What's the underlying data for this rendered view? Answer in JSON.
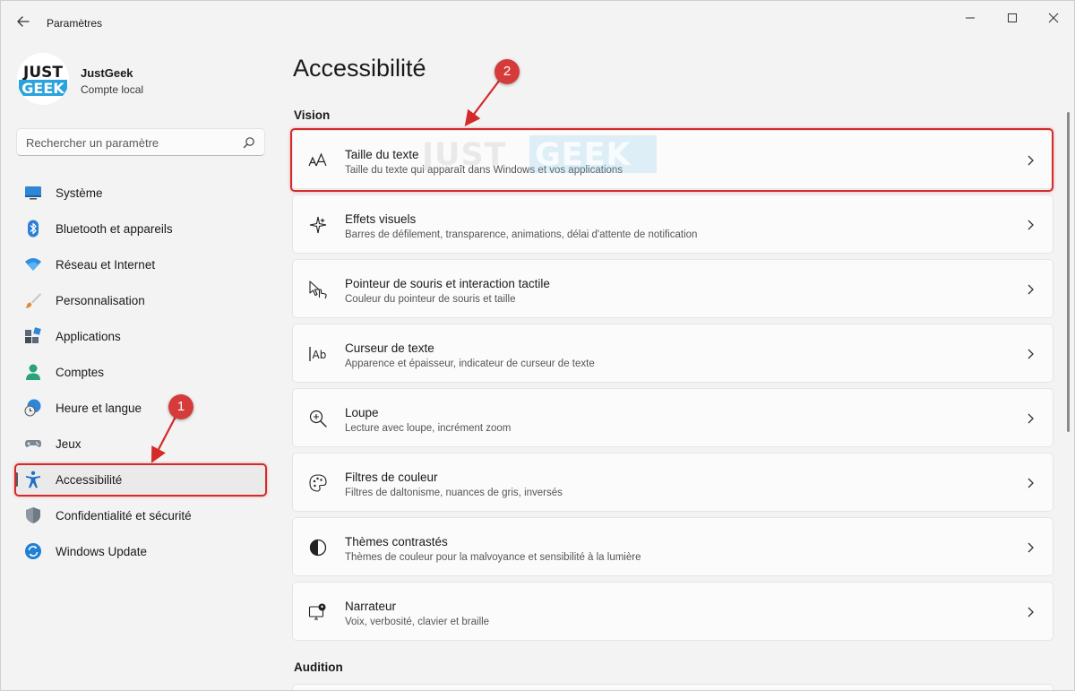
{
  "window": {
    "title": "Paramètres"
  },
  "account": {
    "logo_top": "JUST",
    "logo_bottom": "GEEK",
    "name": "JustGeek",
    "type": "Compte local"
  },
  "search": {
    "placeholder": "Rechercher un paramètre"
  },
  "nav": {
    "items": [
      {
        "label": "Système",
        "icon": "monitor-icon"
      },
      {
        "label": "Bluetooth et appareils",
        "icon": "bluetooth-icon"
      },
      {
        "label": "Réseau et Internet",
        "icon": "wifi-icon"
      },
      {
        "label": "Personnalisation",
        "icon": "brush-icon"
      },
      {
        "label": "Applications",
        "icon": "apps-icon"
      },
      {
        "label": "Comptes",
        "icon": "person-icon"
      },
      {
        "label": "Heure et langue",
        "icon": "clock-globe-icon"
      },
      {
        "label": "Jeux",
        "icon": "gamepad-icon"
      },
      {
        "label": "Accessibilité",
        "icon": "accessibility-icon",
        "active": true
      },
      {
        "label": "Confidentialité et sécurité",
        "icon": "shield-icon"
      },
      {
        "label": "Windows Update",
        "icon": "update-icon"
      }
    ]
  },
  "main": {
    "title": "Accessibilité",
    "sections": [
      {
        "title": "Vision"
      },
      {
        "title": "Audition"
      }
    ],
    "cards": [
      {
        "title": "Taille du texte",
        "desc": "Taille du texte qui apparaît dans Windows et vos applications",
        "icon": "text-size-icon"
      },
      {
        "title": "Effets visuels",
        "desc": "Barres de défilement, transparence, animations, délai d'attente de notification",
        "icon": "sparkle-icon"
      },
      {
        "title": "Pointeur de souris et interaction tactile",
        "desc": "Couleur du pointeur de souris et taille",
        "icon": "pointer-touch-icon"
      },
      {
        "title": "Curseur de texte",
        "desc": "Apparence et épaisseur, indicateur de curseur de texte",
        "icon": "text-cursor-icon"
      },
      {
        "title": "Loupe",
        "desc": "Lecture avec loupe, incrément zoom",
        "icon": "magnifier-icon"
      },
      {
        "title": "Filtres de couleur",
        "desc": "Filtres de daltonisme, nuances de gris, inversés",
        "icon": "palette-icon"
      },
      {
        "title": "Thèmes contrastés",
        "desc": "Thèmes de couleur pour la malvoyance et sensibilité à la lumière",
        "icon": "contrast-icon"
      },
      {
        "title": "Narrateur",
        "desc": "Voix, verbosité, clavier et braille",
        "icon": "narrator-icon"
      }
    ]
  },
  "annotations": {
    "badge_1": "1",
    "badge_2": "2",
    "watermark_just": "JUST",
    "watermark_geek": "GEEK",
    "color": "#d42a2a"
  },
  "colors": {
    "accent": "#0067c0",
    "background": "#f3f3f3",
    "card": "#fbfbfb"
  }
}
